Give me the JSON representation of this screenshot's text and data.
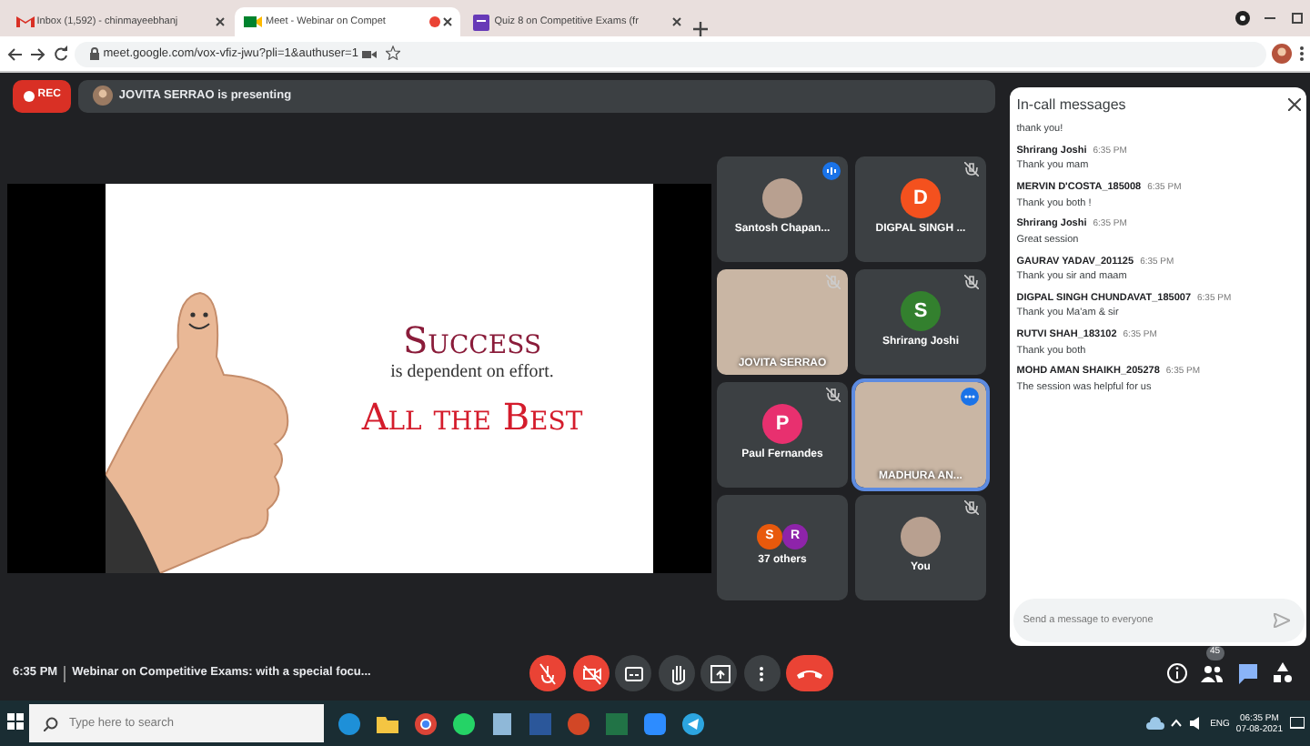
{
  "browser": {
    "tabs": [
      {
        "label": "Inbox (1,592) - chinmayeebhanj",
        "selected": false,
        "kind": "mail"
      },
      {
        "label": "Meet - Webinar on Compet",
        "selected": true,
        "kind": "meet",
        "recording": true
      },
      {
        "label": "Quiz 8 on Competitive Exams (fr",
        "selected": false,
        "kind": "form"
      }
    ],
    "url": "meet.google.com/vox-vfiz-jwu?pli=1&authuser=1"
  },
  "meeting": {
    "rec_label": "REC",
    "presenting": "JOVITA SERRAO is presenting",
    "slide": {
      "headline": "Success",
      "subtitle": "is dependent on effort.",
      "tagline": "All the Best"
    },
    "participants": [
      {
        "name": "Santosh Chapan...",
        "kind": "photo",
        "muted": false,
        "speaking": true,
        "selected": false
      },
      {
        "name": "DIGPAL SINGH ...",
        "kind": "letter",
        "initial": "D",
        "color": "#f4511e",
        "muted": true,
        "speaking": false,
        "selected": false
      },
      {
        "name": "JOVITA SERRAO",
        "kind": "video",
        "muted": true,
        "speaking": false,
        "selected": false
      },
      {
        "name": "Shrirang Joshi",
        "kind": "letter",
        "initial": "S",
        "color": "#33802e",
        "muted": true,
        "speaking": false,
        "selected": false
      },
      {
        "name": "Paul Fernandes",
        "kind": "letter",
        "initial": "P",
        "color": "#e8306f",
        "muted": true,
        "speaking": false,
        "selected": false
      },
      {
        "name": "MADHURA AN...",
        "kind": "video",
        "muted": false,
        "speaking": false,
        "selected": true
      },
      {
        "name": "37 others",
        "kind": "others",
        "avatars": [
          {
            "initial": "S",
            "color": "#e8590c"
          },
          {
            "initial": "R",
            "color": "#8e24aa"
          }
        ],
        "muted": false,
        "speaking": false,
        "selected": false
      },
      {
        "name": "You",
        "kind": "photo",
        "muted": true,
        "speaking": false,
        "selected": false
      }
    ],
    "time": "6:35 PM",
    "title": "Webinar on Competitive Exams: with a special focu...",
    "controls": [
      {
        "kind": "mic",
        "off": true
      },
      {
        "kind": "camera",
        "off": true
      },
      {
        "kind": "captions",
        "off": false
      },
      {
        "kind": "hand",
        "off": false
      },
      {
        "kind": "present",
        "off": false
      },
      {
        "kind": "more",
        "off": false
      },
      {
        "kind": "end",
        "off": true
      }
    ],
    "side_buttons": [
      {
        "kind": "info",
        "selected": false
      },
      {
        "kind": "people",
        "selected": false,
        "badge": "45"
      },
      {
        "kind": "chat",
        "selected": true
      },
      {
        "kind": "activities",
        "selected": false
      }
    ]
  },
  "chat": {
    "title": "In-call messages",
    "messages": [
      {
        "text": "thank you!"
      },
      {
        "sender": "Shrirang Joshi",
        "time": "6:35 PM",
        "text": "Thank you mam"
      },
      {
        "sender": "MERVIN D'COSTA_185008",
        "time": "6:35 PM",
        "text": "Thank you both !"
      },
      {
        "sender": "Shrirang Joshi",
        "time": "6:35 PM",
        "text": "Great session"
      },
      {
        "sender": "GAURAV YADAV_201125",
        "time": "6:35 PM",
        "text": "Thank you sir and maam"
      },
      {
        "sender": "DIGPAL SINGH CHUNDAVAT_185007",
        "time": "6:35 PM",
        "text": "Thank you Ma'am & sir"
      },
      {
        "sender": "RUTVI SHAH_183102",
        "time": "6:35 PM",
        "text": "Thank you both"
      },
      {
        "sender": "MOHD AMAN SHAIKH_205278",
        "time": "6:35 PM",
        "text": "The session was helpful for us"
      }
    ],
    "placeholder": "Send a message to everyone"
  },
  "taskbar": {
    "search_placeholder": "Type here to search",
    "apps": [
      {
        "kind": "edge"
      },
      {
        "kind": "folder"
      },
      {
        "kind": "chrome"
      },
      {
        "kind": "whatsapp"
      },
      {
        "kind": "notes"
      },
      {
        "kind": "word"
      },
      {
        "kind": "powerpoint"
      },
      {
        "kind": "excel"
      },
      {
        "kind": "zoom"
      },
      {
        "kind": "telegram"
      }
    ],
    "language": "ENG",
    "time": "06:35 PM",
    "date": "07-08-2021"
  }
}
